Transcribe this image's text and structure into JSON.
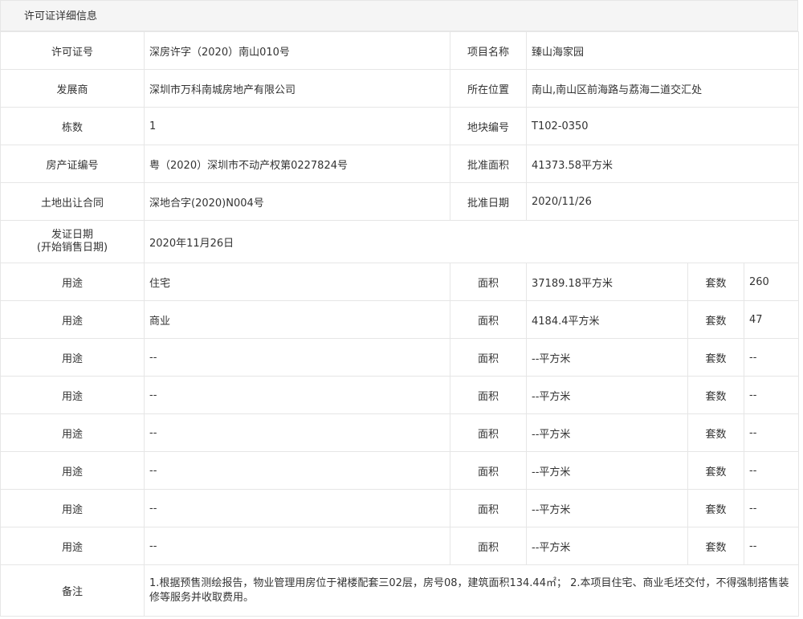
{
  "panel": {
    "title": "许可证详细信息"
  },
  "labels": {
    "permit_no": "许可证号",
    "project_name": "项目名称",
    "developer": "发展商",
    "location": "所在位置",
    "buildings": "栋数",
    "parcel_no": "地块编号",
    "property_cert": "房产证编号",
    "approved_area": "批准面积",
    "land_contract": "土地出让合同",
    "approved_date": "批准日期",
    "issue_date_line1": "发证日期",
    "issue_date_line2": "(开始销售日期)",
    "usage": "用途",
    "area": "面积",
    "units": "套数",
    "remarks": "备注"
  },
  "info": {
    "permit_no": "深房许字（2020）南山010号",
    "project_name": "臻山海家园",
    "developer": "深圳市万科南城房地产有限公司",
    "location": "南山,南山区前海路与荔海二道交汇处",
    "buildings": "1",
    "parcel_no": "T102-0350",
    "property_cert": "粤（2020）深圳市不动产权第0227824号",
    "approved_area": "41373.58平方米",
    "land_contract": "深地合字(2020)N004号",
    "approved_date": "2020/11/26",
    "issue_date": "2020年11月26日"
  },
  "usage_rows": [
    {
      "usage": "住宅",
      "area": "37189.18平方米",
      "units": "260"
    },
    {
      "usage": "商业",
      "area": "4184.4平方米",
      "units": "47"
    },
    {
      "usage": "--",
      "area": "--平方米",
      "units": "--"
    },
    {
      "usage": "--",
      "area": "--平方米",
      "units": "--"
    },
    {
      "usage": "--",
      "area": "--平方米",
      "units": "--"
    },
    {
      "usage": "--",
      "area": "--平方米",
      "units": "--"
    },
    {
      "usage": "--",
      "area": "--平方米",
      "units": "--"
    },
    {
      "usage": "--",
      "area": "--平方米",
      "units": "--"
    }
  ],
  "remarks": "1.根据预售测绘报告，物业管理用房位于裙楼配套三02层，房号08，建筑面积134.44㎡； 2.本项目住宅、商业毛坯交付，不得强制搭售装修等服务并收取费用。"
}
